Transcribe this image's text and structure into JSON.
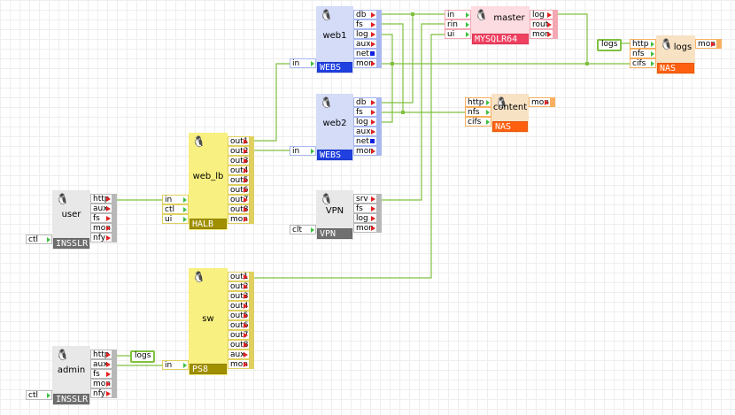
{
  "wire_color": "#80c040",
  "themes": {
    "web": {
      "body": "#d4dcf8",
      "label": "#2040e0",
      "border": "#a8b8f0"
    },
    "db": {
      "body": "#fcdce0",
      "label": "#f04060",
      "border": "#f4a8b4"
    },
    "nas": {
      "body": "#f8e2c4",
      "label": "#ff6010",
      "border": "#f8b060"
    },
    "lb": {
      "body": "#f8f080",
      "label": "#a09000",
      "border": "#e0d060"
    },
    "host": {
      "body": "#e8e8e8",
      "label": "#707070",
      "border": "#b8b8b8"
    }
  },
  "nodes": [
    {
      "id": "web1",
      "title": "web1",
      "label": "WEBS",
      "theme": "web",
      "inputs": [
        "in"
      ],
      "outputs": [
        "db",
        "fs",
        "log",
        "aux",
        "net",
        "mon"
      ]
    },
    {
      "id": "web2",
      "title": "web2",
      "label": "WEBS",
      "theme": "web",
      "inputs": [
        "in"
      ],
      "outputs": [
        "db",
        "fs",
        "log",
        "aux",
        "net",
        "mon"
      ]
    },
    {
      "id": "master",
      "title": "master",
      "label": "MYSQLR64",
      "theme": "db",
      "inputs": [
        "in",
        "rin",
        "ui"
      ],
      "outputs": [
        "log",
        "rout",
        "mon"
      ]
    },
    {
      "id": "logs",
      "title": "logs",
      "label": "NAS",
      "theme": "nas",
      "inputs": [
        "http",
        "nfs",
        "cifs"
      ],
      "outputs": [
        "mon"
      ]
    },
    {
      "id": "content",
      "title": "content",
      "label": "NAS",
      "theme": "nas",
      "inputs": [
        "http",
        "nfs",
        "cifs"
      ],
      "outputs": [
        "mon"
      ]
    },
    {
      "id": "web_lb",
      "title": "web_lb",
      "label": "HALB",
      "theme": "lb",
      "inputs": [
        "in",
        "ctl",
        "ui"
      ],
      "outputs": [
        "out1",
        "out2",
        "out3",
        "out4",
        "out5",
        "out6",
        "out7",
        "out8",
        "mon"
      ]
    },
    {
      "id": "user",
      "title": "user",
      "label": "INSSLR",
      "theme": "host",
      "inputs": [
        "ctl"
      ],
      "outputs": [
        "http",
        "aux",
        "fs",
        "mon",
        "nfy"
      ]
    },
    {
      "id": "vpn",
      "title": "VPN",
      "label": "VPN",
      "theme": "host",
      "inputs": [
        "clt"
      ],
      "outputs": [
        "srv",
        "fs",
        "log",
        "mon"
      ]
    },
    {
      "id": "sw",
      "title": "sw",
      "label": "PS8",
      "theme": "lb",
      "inputs": [
        "in"
      ],
      "outputs": [
        "out1",
        "out2",
        "out3",
        "out4",
        "out5",
        "out6",
        "out7",
        "out8",
        "aux",
        "mon"
      ]
    },
    {
      "id": "admin",
      "title": "admin",
      "label": "INSSLR",
      "theme": "host",
      "inputs": [
        "ctl"
      ],
      "outputs": [
        "http",
        "aux",
        "fs",
        "mon",
        "nfy"
      ]
    }
  ],
  "tags": [
    {
      "id": "logs-tag-1",
      "text": "logs"
    },
    {
      "id": "logs-tag-2",
      "text": "logs"
    }
  ]
}
